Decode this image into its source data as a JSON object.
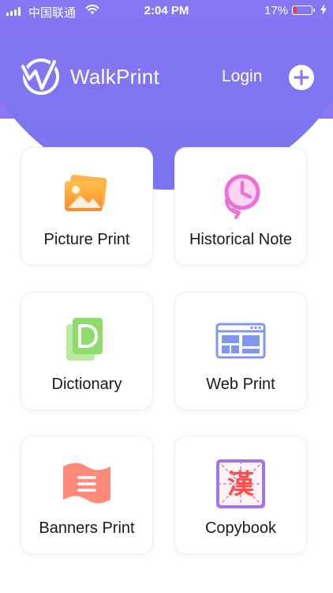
{
  "status_bar": {
    "carrier": "中国联通",
    "time": "2:04 PM",
    "battery_percent": "17%",
    "battery_level": 0.17
  },
  "header": {
    "app_name": "WalkPrint",
    "login_label": "Login",
    "add_icon": "plus-circle-icon"
  },
  "colors": {
    "header_purple": "#8a78f2",
    "card_border": "#eceef8"
  },
  "features": [
    {
      "label": "Picture Print",
      "icon": "picture-icon"
    },
    {
      "label": "Historical Note",
      "icon": "history-clock-icon"
    },
    {
      "label": "Dictionary",
      "icon": "dictionary-icon"
    },
    {
      "label": "Web Print",
      "icon": "web-page-icon"
    },
    {
      "label": "Banners Print",
      "icon": "banner-icon"
    },
    {
      "label": "Copybook",
      "icon": "copybook-icon",
      "glyph": "漢"
    }
  ]
}
